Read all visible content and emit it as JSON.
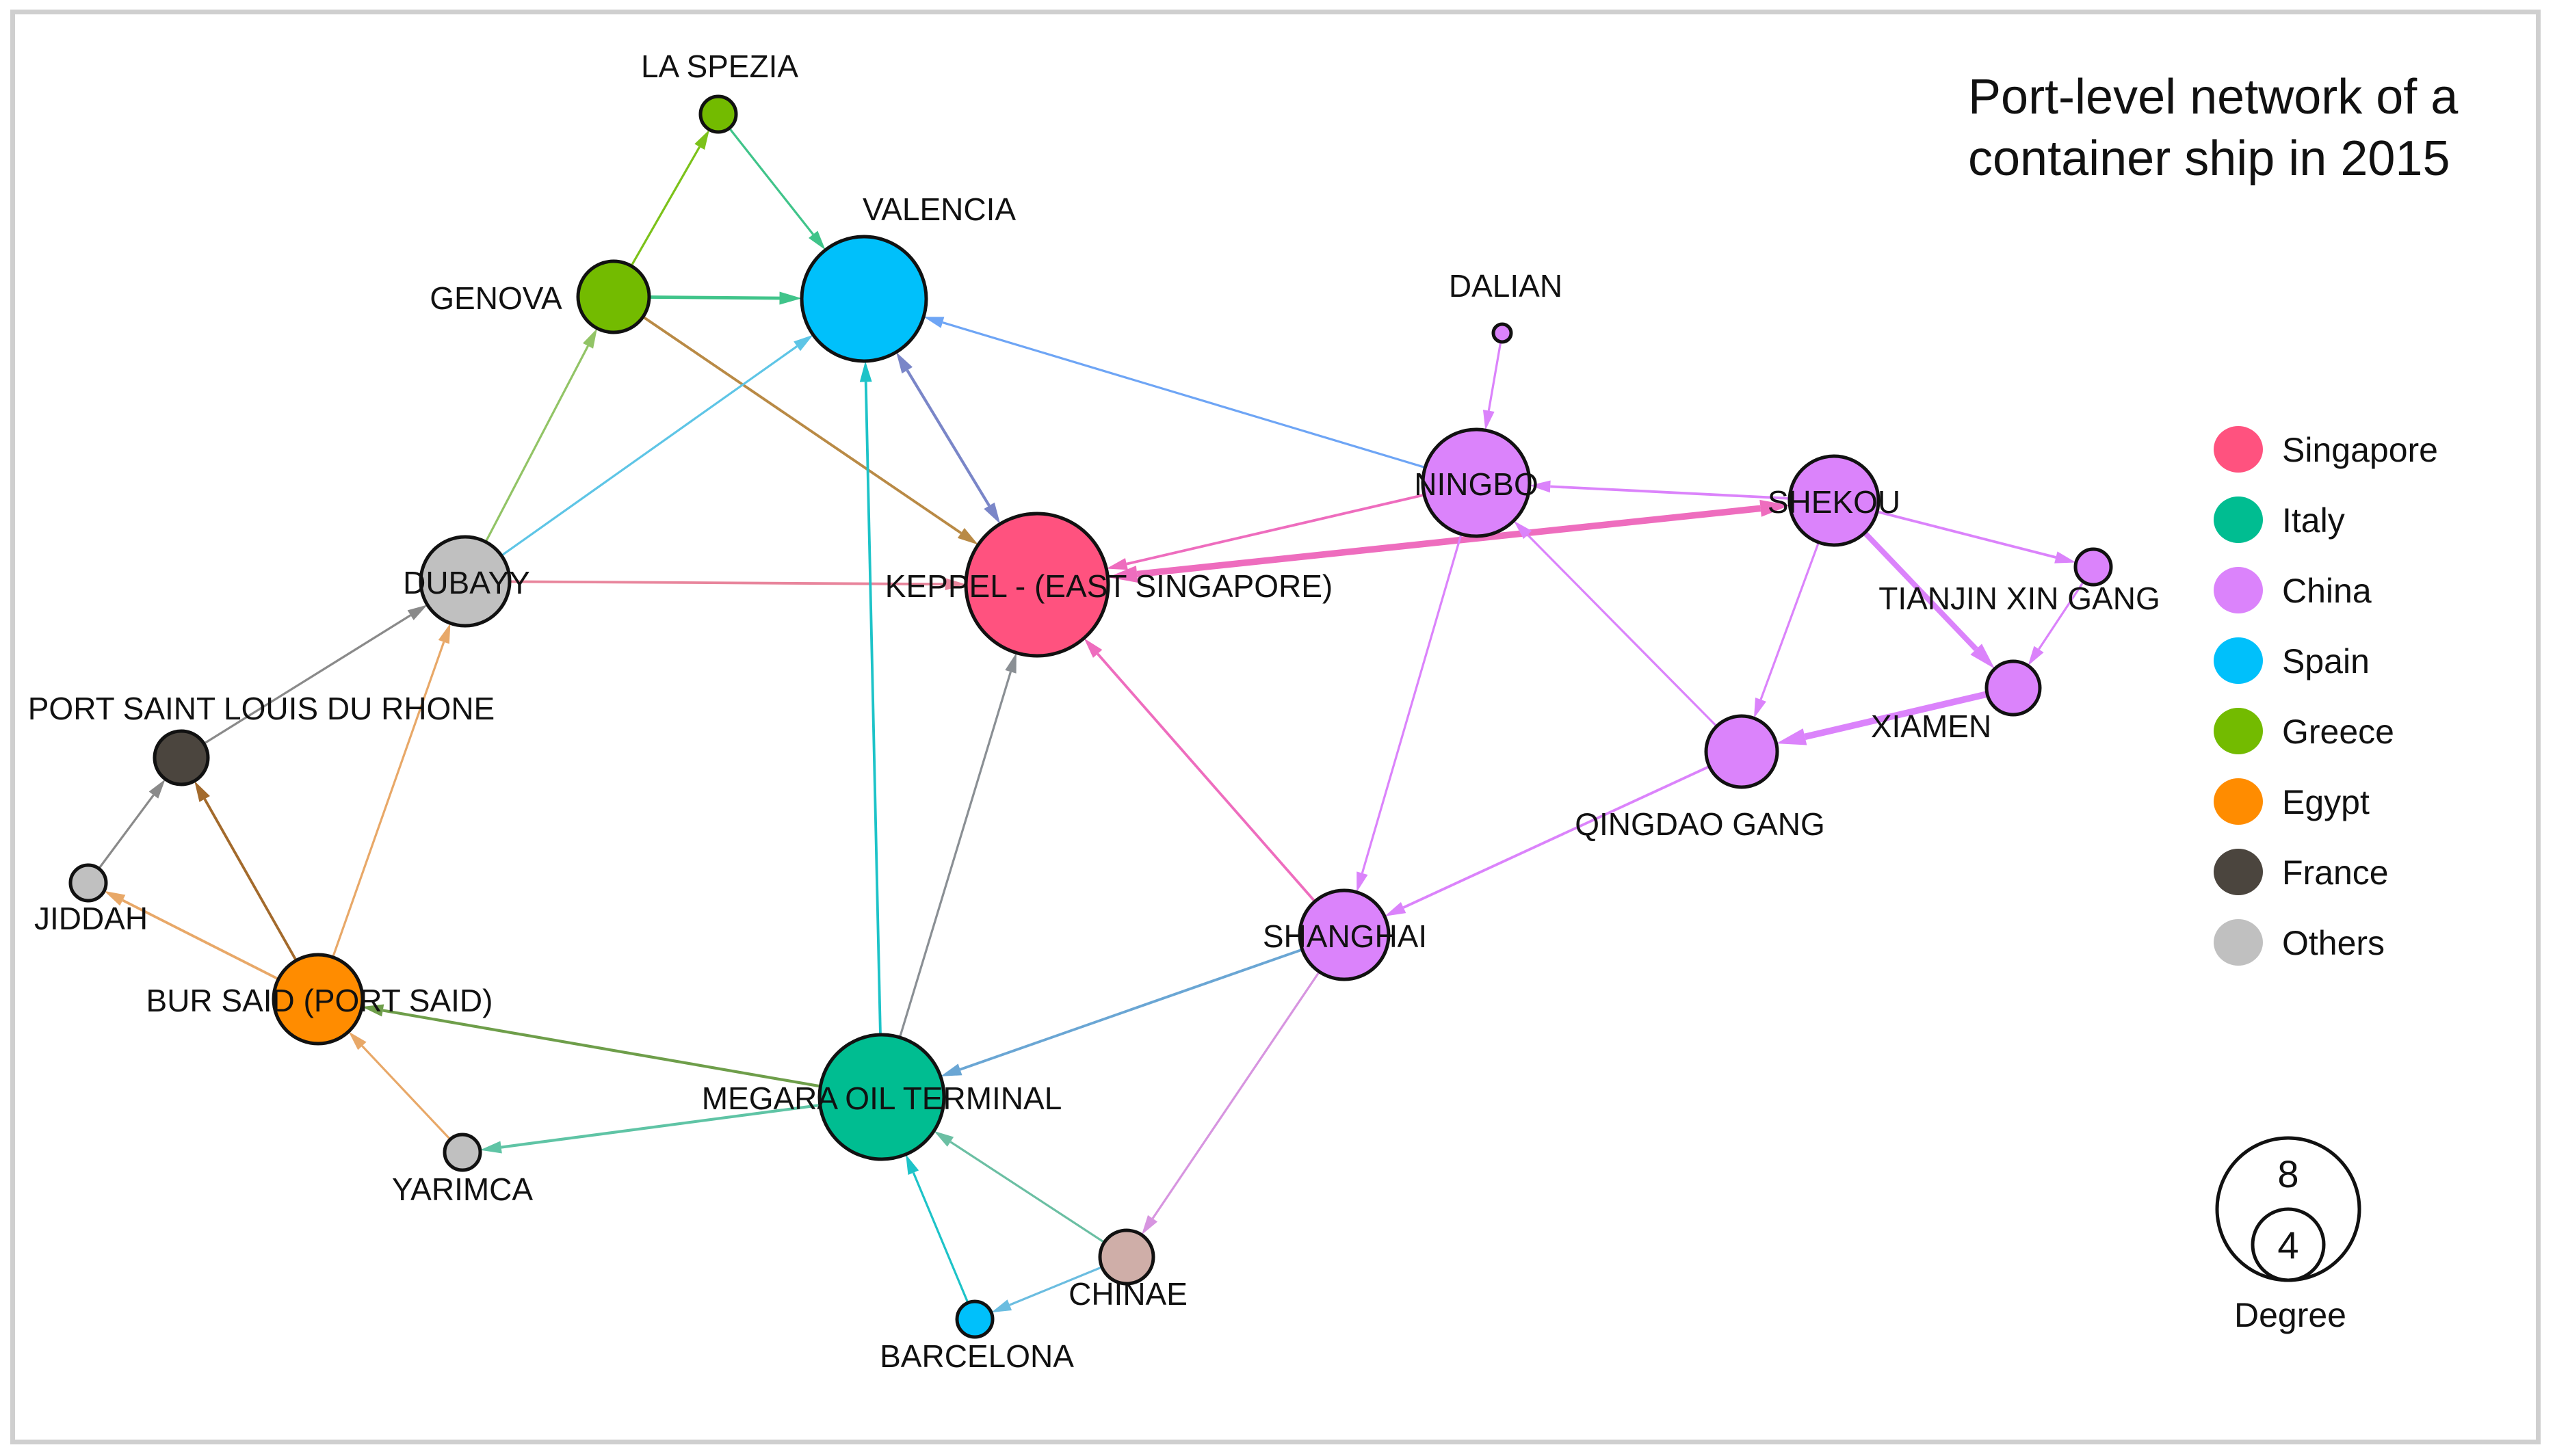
{
  "title": {
    "line1": "Port-level network of a",
    "line2": "container ship in 2015"
  },
  "chart_data": {
    "type": "network",
    "directed": true,
    "title": "Port-level network of a container ship in 2015",
    "color_legend": [
      {
        "country": "Singapore",
        "color": "#ff527f"
      },
      {
        "country": "Italy",
        "color": "#00bd91"
      },
      {
        "country": "China",
        "color": "#db83fb"
      },
      {
        "country": "Spain",
        "color": "#00c0fb"
      },
      {
        "country": "Greece",
        "color": "#73bb00"
      },
      {
        "country": "Egypt",
        "color": "#ff8c00"
      },
      {
        "country": "France",
        "color": "#4b453e"
      },
      {
        "country": "Others",
        "color": "#c0c0c0"
      }
    ],
    "size_legend": {
      "title": "Degree",
      "values": [
        8,
        4
      ]
    },
    "nodes": [
      {
        "id": "LA SPEZIA",
        "group": "Greece",
        "degree": 2,
        "label_pos": "above"
      },
      {
        "id": "GENOVA",
        "group": "Greece",
        "degree": 4,
        "label_pos": "left"
      },
      {
        "id": "VALENCIA",
        "group": "Spain",
        "degree": 7,
        "label_pos": "above-right"
      },
      {
        "id": "DUBAYY",
        "group": "Others",
        "degree": 5,
        "label_pos": "center"
      },
      {
        "id": "KEPPEL - (EAST SINGAPORE)",
        "group": "Singapore",
        "degree": 8,
        "label_pos": "center"
      },
      {
        "id": "PORT SAINT LOUIS DU RHONE",
        "group": "France",
        "degree": 3,
        "label_pos": "above"
      },
      {
        "id": "JIDDAH",
        "group": "Others",
        "degree": 2,
        "label_pos": "below"
      },
      {
        "id": "BUR SAID (PORT SAID)",
        "group": "Egypt",
        "degree": 5,
        "label_pos": "center"
      },
      {
        "id": "YARIMCA",
        "group": "Others",
        "degree": 2,
        "label_pos": "below"
      },
      {
        "id": "MEGARA OIL TERMINAL",
        "group": "Italy",
        "degree": 7,
        "label_pos": "center"
      },
      {
        "id": "CHINAE",
        "group": "Others-brown",
        "color": "#cfaea8",
        "degree": 3,
        "label_pos": "below"
      },
      {
        "id": "BARCELONA",
        "group": "Spain",
        "degree": 2,
        "label_pos": "below"
      },
      {
        "id": "SHANGHAI",
        "group": "China",
        "degree": 5,
        "label_pos": "center"
      },
      {
        "id": "NINGBO",
        "group": "China",
        "degree": 6,
        "label_pos": "center"
      },
      {
        "id": "SHEKOU",
        "group": "China",
        "degree": 5,
        "label_pos": "center"
      },
      {
        "id": "DALIAN",
        "group": "China",
        "degree": 1,
        "label_pos": "above"
      },
      {
        "id": "TIANJIN XIN GANG",
        "group": "China",
        "degree": 2,
        "label_pos": "below-left"
      },
      {
        "id": "XIAMEN",
        "group": "China",
        "degree": 3,
        "label_pos": "below-left"
      },
      {
        "id": "QINGDAO GANG",
        "group": "China",
        "degree": 4,
        "label_pos": "below"
      }
    ],
    "edges": [
      {
        "from": "GENOVA",
        "to": "LA SPEZIA",
        "color": "#7cc21a",
        "weight": 1
      },
      {
        "from": "LA SPEZIA",
        "to": "VALENCIA",
        "color": "#40c48a",
        "weight": 1
      },
      {
        "from": "GENOVA",
        "to": "VALENCIA",
        "color": "#40c48a",
        "weight": 1.5
      },
      {
        "from": "GENOVA",
        "to": "KEPPEL - (EAST SINGAPORE)",
        "color": "#b98a45",
        "weight": 1.2
      },
      {
        "from": "DUBAYY",
        "to": "GENOVA",
        "color": "#92c466",
        "weight": 1
      },
      {
        "from": "DUBAYY",
        "to": "VALENCIA",
        "color": "#5ec5e6",
        "weight": 1
      },
      {
        "from": "DUBAYY",
        "to": "KEPPEL - (EAST SINGAPORE)",
        "color": "#e8859c",
        "weight": 1.2
      },
      {
        "from": "VALENCIA",
        "to": "KEPPEL - (EAST SINGAPORE)",
        "color": "#7a86c8",
        "weight": 1.3,
        "bidirectional": true
      },
      {
        "from": "NINGBO",
        "to": "VALENCIA",
        "color": "#6ea5f5",
        "weight": 1
      },
      {
        "from": "MEGARA OIL TERMINAL",
        "to": "VALENCIA",
        "color": "#1dc3c8",
        "weight": 1.2
      },
      {
        "from": "MEGARA OIL TERMINAL",
        "to": "KEPPEL - (EAST SINGAPORE)",
        "color": "#8a8f94",
        "weight": 1
      },
      {
        "from": "NINGBO",
        "to": "KEPPEL - (EAST SINGAPORE)",
        "color": "#ee6dbe",
        "weight": 1.2
      },
      {
        "from": "KEPPEL - (EAST SINGAPORE)",
        "to": "SHEKOU",
        "color": "#ee6dbe",
        "weight": 3,
        "bidirectional": true
      },
      {
        "from": "SHANGHAI",
        "to": "KEPPEL - (EAST SINGAPORE)",
        "color": "#ee6dbe",
        "weight": 1.2
      },
      {
        "from": "SHEKOU",
        "to": "NINGBO",
        "color": "#db83fb",
        "weight": 1.2
      },
      {
        "from": "DALIAN",
        "to": "NINGBO",
        "color": "#db83fb",
        "weight": 1
      },
      {
        "from": "NINGBO",
        "to": "SHANGHAI",
        "color": "#db83fb",
        "weight": 1
      },
      {
        "from": "QINGDAO GANG",
        "to": "NINGBO",
        "color": "#db83fb",
        "weight": 1
      },
      {
        "from": "SHEKOU",
        "to": "TIANJIN XIN GANG",
        "color": "#db83fb",
        "weight": 1.2
      },
      {
        "from": "SHEKOU",
        "to": "XIAMEN",
        "color": "#db83fb",
        "weight": 2.5
      },
      {
        "from": "SHEKOU",
        "to": "QINGDAO GANG",
        "color": "#db83fb",
        "weight": 1
      },
      {
        "from": "TIANJIN XIN GANG",
        "to": "XIAMEN",
        "color": "#db83fb",
        "weight": 1
      },
      {
        "from": "XIAMEN",
        "to": "QINGDAO GANG",
        "color": "#db83fb",
        "weight": 3
      },
      {
        "from": "QINGDAO GANG",
        "to": "SHANGHAI",
        "color": "#db83fb",
        "weight": 1.2
      },
      {
        "from": "SHANGHAI",
        "to": "MEGARA OIL TERMINAL",
        "color": "#6aa6d4",
        "weight": 1.2
      },
      {
        "from": "SHANGHAI",
        "to": "CHINAE",
        "color": "#d795e0",
        "weight": 1
      },
      {
        "from": "CHINAE",
        "to": "MEGARA OIL TERMINAL",
        "color": "#6bbfa3",
        "weight": 1
      },
      {
        "from": "CHINAE",
        "to": "BARCELONA",
        "color": "#6bbde0",
        "weight": 1
      },
      {
        "from": "BARCELONA",
        "to": "MEGARA OIL TERMINAL",
        "color": "#1dc3c8",
        "weight": 1
      },
      {
        "from": "MEGARA OIL TERMINAL",
        "to": "BUR SAID (PORT SAID)",
        "color": "#6e9e4a",
        "weight": 1.3
      },
      {
        "from": "MEGARA OIL TERMINAL",
        "to": "YARIMCA",
        "color": "#5fc4a5",
        "weight": 1.3
      },
      {
        "from": "YARIMCA",
        "to": "BUR SAID (PORT SAID)",
        "color": "#e8a868",
        "weight": 1
      },
      {
        "from": "BUR SAID (PORT SAID)",
        "to": "DUBAYY",
        "color": "#e8a868",
        "weight": 1
      },
      {
        "from": "BUR SAID (PORT SAID)",
        "to": "PORT SAINT LOUIS DU RHONE",
        "color": "#a36a2c",
        "weight": 1.2
      },
      {
        "from": "BUR SAID (PORT SAID)",
        "to": "JIDDAH",
        "color": "#e8a868",
        "weight": 1.2
      },
      {
        "from": "JIDDAH",
        "to": "PORT SAINT LOUIS DU RHONE",
        "color": "#8a8a8a",
        "weight": 1
      },
      {
        "from": "PORT SAINT LOUIS DU RHONE",
        "to": "DUBAYY",
        "color": "#8a8a8a",
        "weight": 1
      }
    ]
  }
}
